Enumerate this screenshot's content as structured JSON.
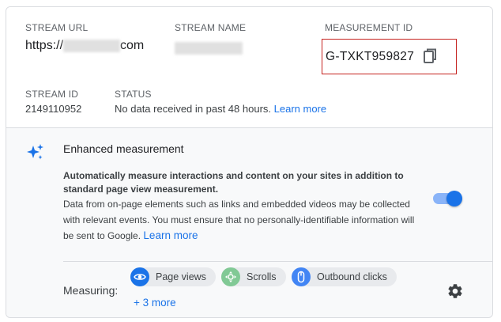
{
  "stream": {
    "url_label": "STREAM URL",
    "url_prefix": "https://",
    "url_suffix": "com",
    "name_label": "STREAM NAME",
    "measurement_label": "MEASUREMENT ID",
    "measurement_id": "G-TXKT959827",
    "id_label": "STREAM ID",
    "stream_id": "2149110952",
    "status_label": "STATUS",
    "status_text": "No data received in past 48 hours.",
    "status_link": "Learn more"
  },
  "enhanced": {
    "title": "Enhanced measurement",
    "desc_bold_1": "Automatically measure interactions and content on your sites in addition to",
    "desc_bold_2": "standard page view measurement.",
    "desc_1": "Data from on-page elements such as links and embedded videos may be collected",
    "desc_2": "with relevant events. You must ensure that no personally-identifiable information will",
    "desc_3": "be sent to Google.",
    "desc_link": "Learn more",
    "toggle_on": true
  },
  "measuring": {
    "label": "Measuring:",
    "chips": [
      {
        "label": "Page views",
        "icon": "eye-icon",
        "color": "#1a73e8"
      },
      {
        "label": "Scrolls",
        "icon": "crosshair-icon",
        "color": "#81c995"
      },
      {
        "label": "Outbound clicks",
        "icon": "mouse-icon",
        "color": "#4285f4"
      }
    ],
    "more_link": "+ 3 more"
  },
  "colors": {
    "accent": "#1a73e8",
    "highlight_box": "#c5221f"
  }
}
